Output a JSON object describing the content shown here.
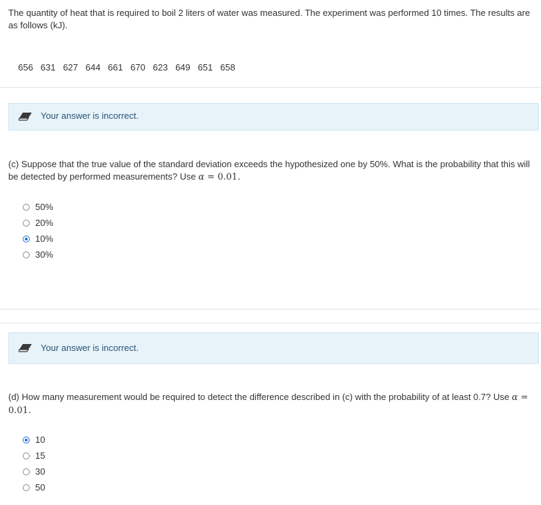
{
  "intro": {
    "text": "The quantity of heat that is required to boil 2 liters of water was measured. The experiment was performed 10 times. The results are as follows (kJ)."
  },
  "measurements": [
    "656",
    "631",
    "627",
    "644",
    "661",
    "670",
    "623",
    "649",
    "651",
    "658"
  ],
  "feedback": {
    "incorrect_text": "Your answer is incorrect.",
    "colors": {
      "background": "#e7f3f9",
      "text": "#2a5576"
    }
  },
  "question_c": {
    "text_before": "(c) Suppose that the true value of the standard deviation exceeds the hypothesized one by 50%. What is the probability that this will be detected by performed measurements? Use ",
    "math_var": "α",
    "math_rest": " = 0.01.",
    "options": [
      {
        "label": "50%",
        "selected": false
      },
      {
        "label": "20%",
        "selected": false
      },
      {
        "label": "10%",
        "selected": true
      },
      {
        "label": "30%",
        "selected": false
      }
    ]
  },
  "question_d": {
    "text_before": "(d) How many measurement would be required to detect the difference described in (c) with the probability of at least 0.7? Use ",
    "math_var": "α",
    "math_rest": " = 0.01.",
    "options": [
      {
        "label": "10",
        "selected": true
      },
      {
        "label": "15",
        "selected": false
      },
      {
        "label": "30",
        "selected": false
      },
      {
        "label": "50",
        "selected": false
      }
    ]
  },
  "accent_color": "#1f6fce"
}
